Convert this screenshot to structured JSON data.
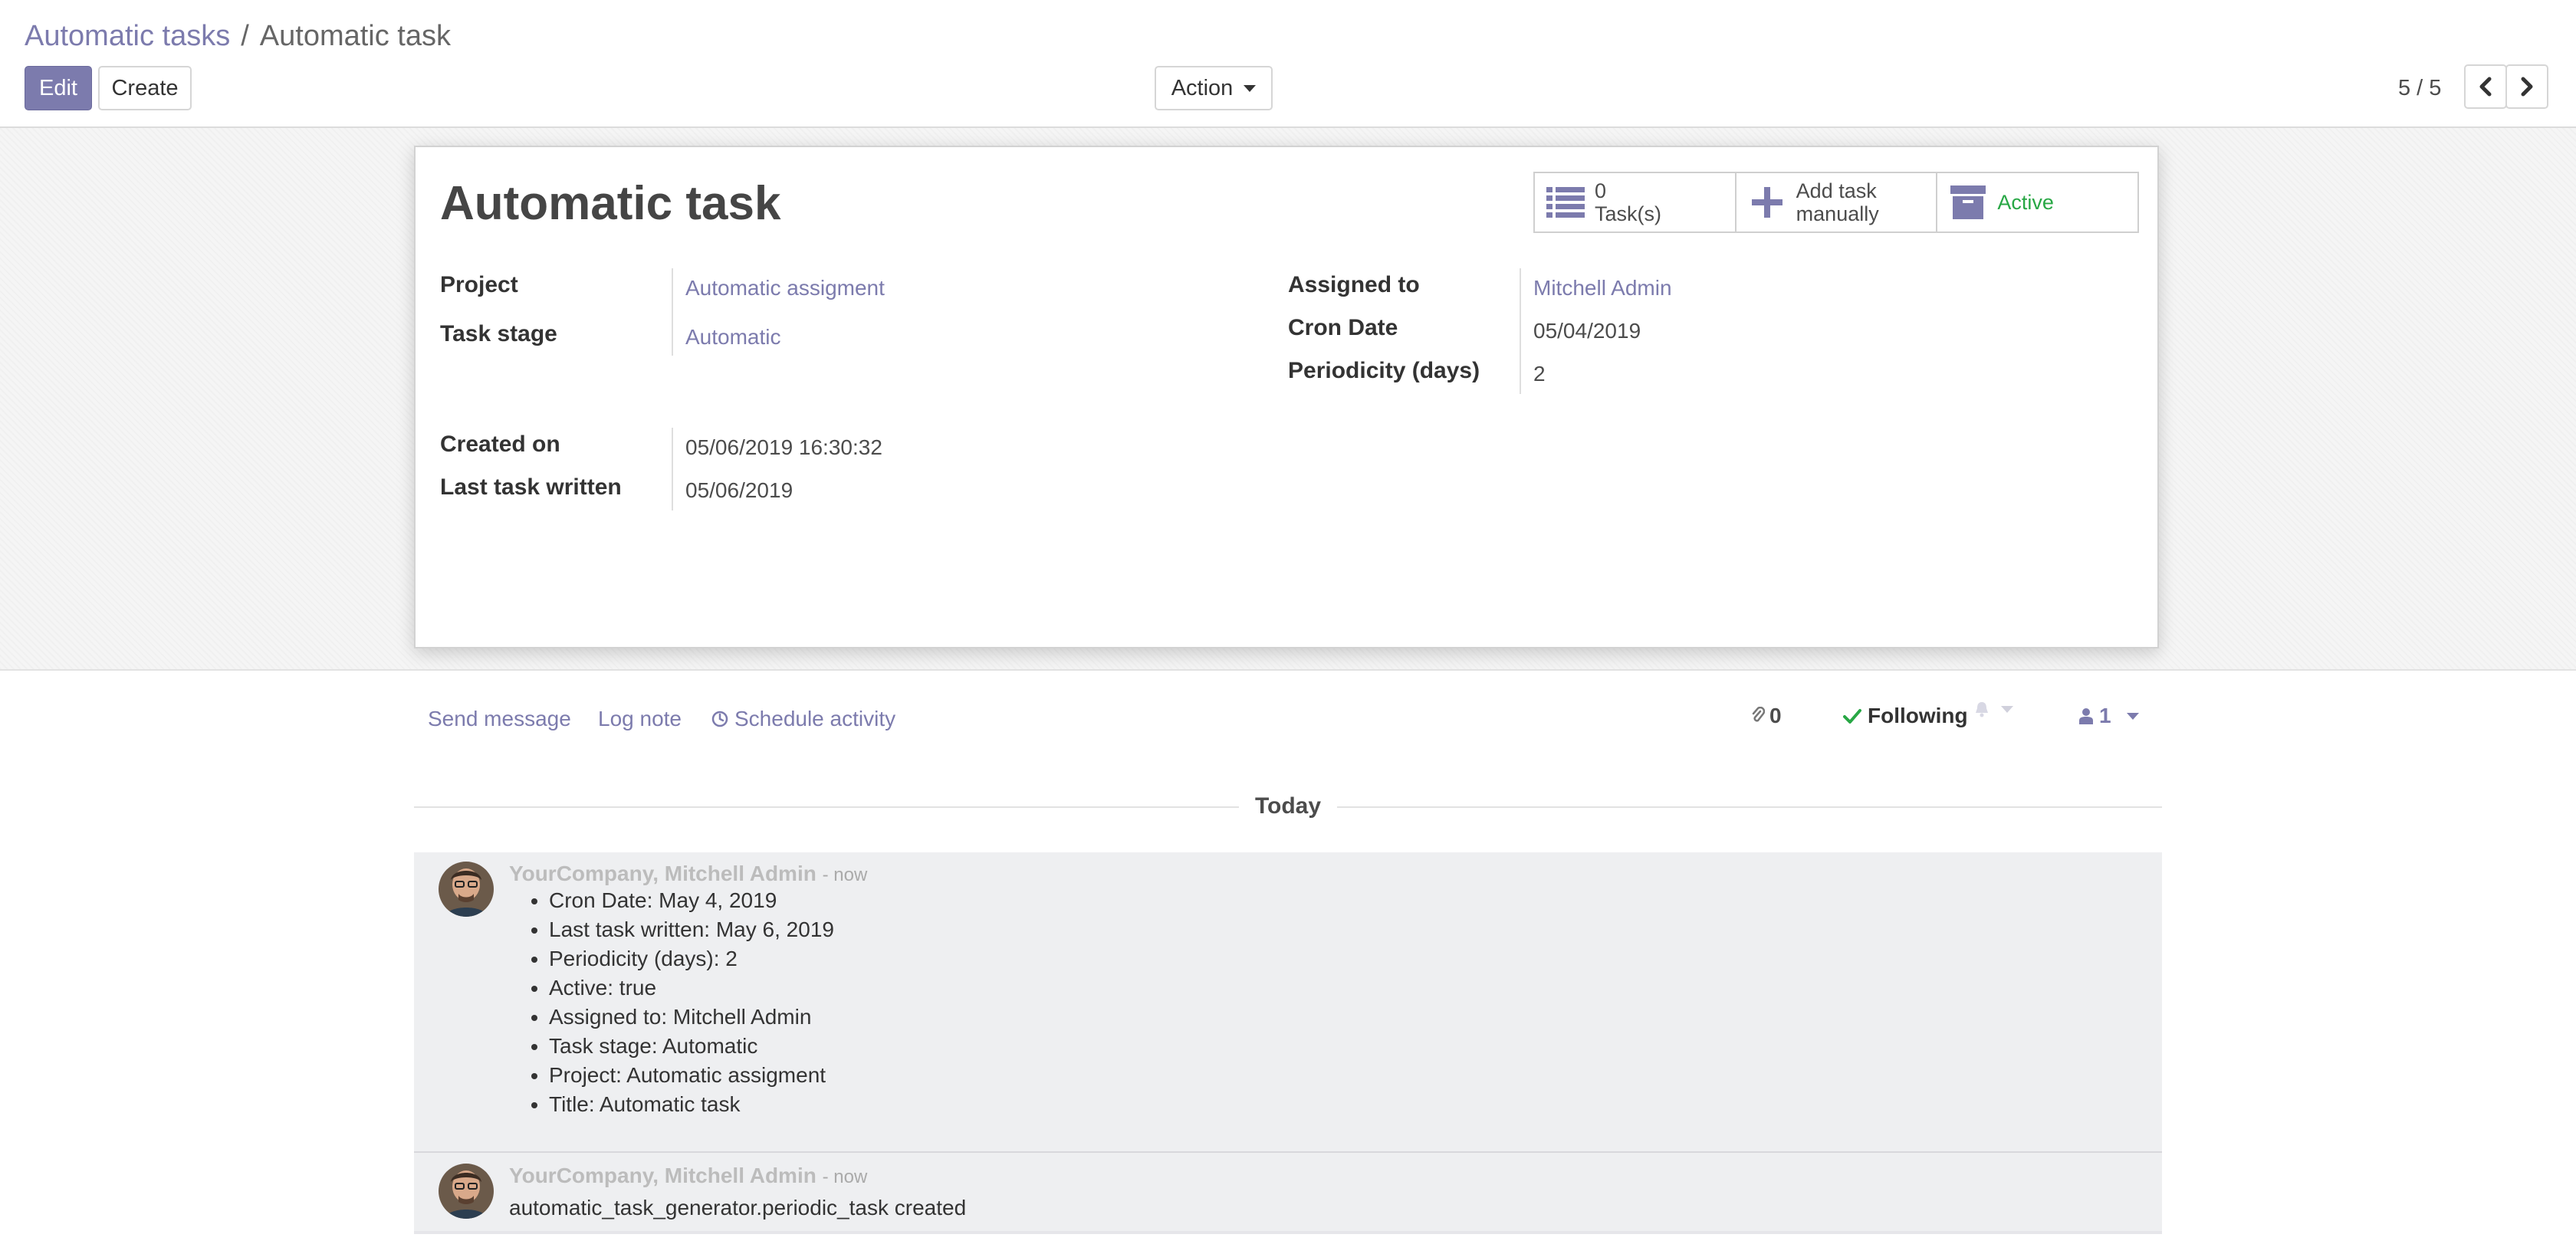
{
  "breadcrumb": {
    "parent": "Automatic tasks",
    "separator": "/",
    "current": "Automatic task"
  },
  "toolbar": {
    "edit_label": "Edit",
    "create_label": "Create",
    "action_label": "Action"
  },
  "pager": {
    "value": "5 / 5"
  },
  "form": {
    "title": "Automatic task",
    "button_box": {
      "tasks_count": "0",
      "tasks_label": "Task(s)",
      "add_task_line1": "Add task",
      "add_task_line2": "manually",
      "active_label": "Active"
    },
    "left_fields": [
      {
        "label": "Project",
        "value": "Automatic assigment"
      },
      {
        "label": "Task stage",
        "value": "Automatic"
      },
      {
        "label": "Created on",
        "value": "05/06/2019 16:30:32"
      },
      {
        "label": "Last task written",
        "value": "05/06/2019"
      }
    ],
    "right_fields": [
      {
        "label": "Assigned to",
        "value": "Mitchell Admin"
      },
      {
        "label": "Cron Date",
        "value": "05/04/2019"
      },
      {
        "label": "Periodicity (days)",
        "value": "2"
      }
    ]
  },
  "chatter": {
    "send_message": "Send message",
    "log_note": "Log note",
    "schedule_activity": "Schedule activity",
    "attachments_count": "0",
    "following_label": "Following",
    "followers_count": "1",
    "today_label": "Today",
    "messages": [
      {
        "author": "YourCompany, Mitchell Admin",
        "date": "- now",
        "tracking": [
          "Cron Date: May 4, 2019",
          "Last task written: May 6, 2019",
          "Periodicity (days): 2",
          "Active: true",
          "Assigned to: Mitchell Admin",
          "Task stage: Automatic",
          "Project: Automatic assigment",
          "Title: Automatic task"
        ]
      },
      {
        "author": "YourCompany, Mitchell Admin",
        "date": "- now",
        "body": "automatic_task_generator.periodic_task created"
      }
    ]
  },
  "colors": {
    "brand": "#7c7bad",
    "active_green": "#28a745",
    "following_green": "#28a745"
  }
}
